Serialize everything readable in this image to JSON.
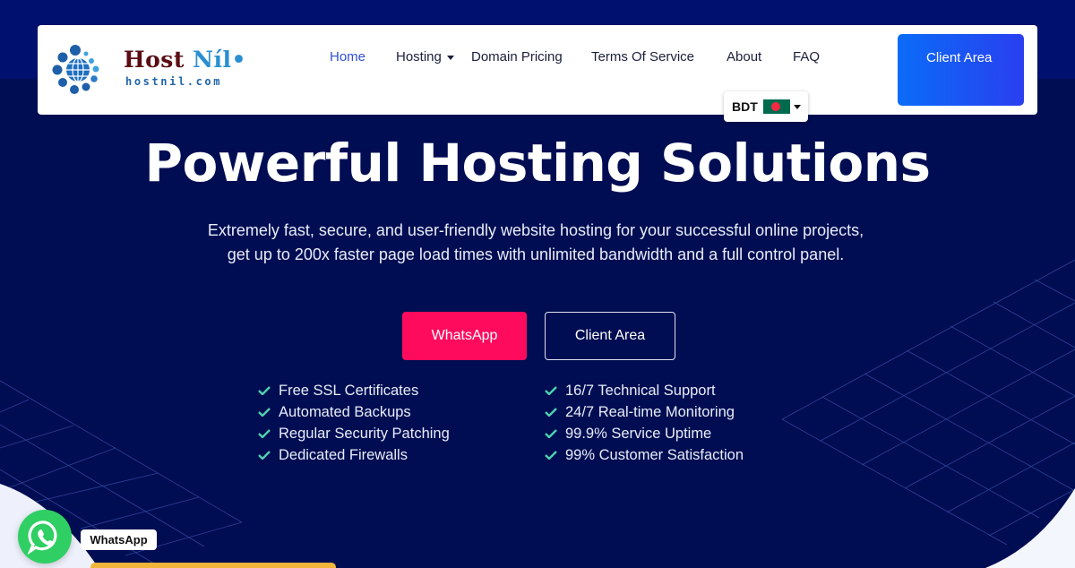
{
  "header": {
    "logo": {
      "brand_part1": "Host",
      "brand_part2": "Níl",
      "domain": "hostnil.com"
    },
    "nav": [
      {
        "label": "Home",
        "active": true
      },
      {
        "label": "Hosting",
        "has_dropdown": true
      },
      {
        "label": "Domain Pricing"
      },
      {
        "label": "Terms Of Service"
      },
      {
        "label": "About"
      },
      {
        "label": "FAQ"
      }
    ],
    "currency": {
      "label": "BDT",
      "flag": "bangladesh-flag"
    },
    "client_area_label": "Client Area"
  },
  "hero": {
    "title": "Powerful Hosting Solutions",
    "subtitle_line1": "Extremely fast, secure, and user-friendly website hosting for your successful online projects,",
    "subtitle_line2": "get up to 200x faster page load times with unlimited bandwidth and a full control panel.",
    "primary_button": "WhatsApp",
    "secondary_button": "Client Area",
    "features_left": [
      "Free SSL Certificates",
      "Automated Backups",
      "Regular Security Patching",
      "Dedicated Firewalls"
    ],
    "features_right": [
      "16/7 Technical Support",
      "24/7 Real-time Monitoring",
      "99.9% Service Uptime",
      "99% Customer Satisfaction"
    ]
  },
  "floating": {
    "whatsapp_tooltip": "WhatsApp"
  },
  "colors": {
    "navy_top": "#00106e",
    "navy_hero": "#000d52",
    "accent_pink": "#fe0b5e",
    "accent_blue": "#0a6cf7",
    "check_green": "#4fd1b0",
    "whatsapp_green": "#2fcf63"
  }
}
